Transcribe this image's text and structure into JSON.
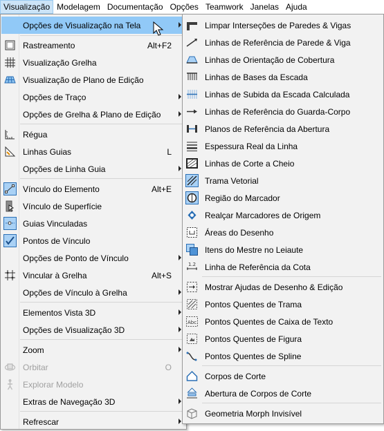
{
  "menubar": {
    "items": [
      "Visualização",
      "Modelagem",
      "Documentação",
      "Opções",
      "Teamwork",
      "Janelas",
      "Ajuda"
    ]
  },
  "main_menu": {
    "items": [
      {
        "label": "Opções de Visualização na Tela",
        "shortcut": "",
        "submenu": true,
        "icon": "none"
      },
      {
        "label": "Rastreamento",
        "shortcut": "Alt+F2",
        "submenu": false,
        "icon": "tracker-icon"
      },
      {
        "label": "Visualização Grelha",
        "shortcut": "",
        "submenu": false,
        "icon": "grid-display-icon"
      },
      {
        "label": "Visualização de Plano de Edição",
        "shortcut": "",
        "submenu": false,
        "icon": "editing-plane-icon"
      },
      {
        "label": "Opções de Traço",
        "shortcut": "",
        "submenu": true,
        "icon": "none"
      },
      {
        "label": "Opções de Grelha & Plano de Edição",
        "shortcut": "",
        "submenu": true,
        "icon": "none"
      },
      {
        "label": "Régua",
        "shortcut": "",
        "submenu": false,
        "icon": "ruler-icon"
      },
      {
        "label": "Linhas Guias",
        "shortcut": "L",
        "submenu": false,
        "icon": "guide-lines-icon"
      },
      {
        "label": "Opções de Linha Guia",
        "shortcut": "",
        "submenu": true,
        "icon": "none"
      },
      {
        "label": "Vínculo do Elemento",
        "shortcut": "Alt+E",
        "submenu": false,
        "icon": "element-snap-icon"
      },
      {
        "label": "Vínculo de Superfície",
        "shortcut": "",
        "submenu": false,
        "icon": "surface-snap-icon"
      },
      {
        "label": "Guias Vinculadas",
        "shortcut": "",
        "submenu": false,
        "icon": "snap-guides-icon"
      },
      {
        "label": "Pontos de Vínculo",
        "shortcut": "",
        "submenu": false,
        "icon": "snap-points-icon"
      },
      {
        "label": "Opções de Ponto de Vínculo",
        "shortcut": "",
        "submenu": true,
        "icon": "none"
      },
      {
        "label": "Vincular à Grelha",
        "shortcut": "Alt+S",
        "submenu": false,
        "icon": "grid-snap-icon"
      },
      {
        "label": "Opções de Vínculo à Grelha",
        "shortcut": "",
        "submenu": true,
        "icon": "none"
      },
      {
        "label": "Elementos Vista 3D",
        "shortcut": "",
        "submenu": true,
        "icon": "none"
      },
      {
        "label": "Opções de Visualização 3D",
        "shortcut": "",
        "submenu": true,
        "icon": "none"
      },
      {
        "label": "Zoom",
        "shortcut": "",
        "submenu": true,
        "icon": "none"
      },
      {
        "label": "Orbitar",
        "shortcut": "O",
        "submenu": false,
        "icon": "orbit-icon",
        "disabled": true
      },
      {
        "label": "Explorar Modelo",
        "shortcut": "",
        "submenu": false,
        "icon": "explore-model-icon",
        "disabled": true
      },
      {
        "label": "Extras de Navegação 3D",
        "shortcut": "",
        "submenu": true,
        "icon": "none"
      },
      {
        "label": "Refrescar",
        "shortcut": "",
        "submenu": true,
        "icon": "none"
      }
    ]
  },
  "sub_menu": {
    "items": [
      {
        "label": "Limpar Interseções  de Paredes & Vigas",
        "icon": "clean-intersections-icon"
      },
      {
        "label": "Linhas de Referência de Parede & Viga",
        "icon": "reference-line-icon"
      },
      {
        "label": "Linhas de Orientação de Cobertura",
        "icon": "roof-pivot-icon"
      },
      {
        "label": "Linhas de Bases da Escada",
        "icon": "stair-baseline-icon"
      },
      {
        "label": "Linhas de Subida da Escada Calculada",
        "icon": "stair-walkline-icon"
      },
      {
        "label": "Linhas de Referência do Guarda-Corpo",
        "icon": "railing-reference-icon"
      },
      {
        "label": "Planos de Referência da Abertura",
        "icon": "opening-reference-icon"
      },
      {
        "label": "Espessura Real da Linha",
        "icon": "true-line-weight-icon"
      },
      {
        "label": "Linhas de Corte a Cheio",
        "icon": "bold-cut-lines-icon"
      },
      {
        "label": "Trama Vetorial",
        "icon": "vectorial-hatching-icon"
      },
      {
        "label": "Região do Marcador",
        "icon": "marker-region-icon"
      },
      {
        "label": "Realçar Marcadores de Origem",
        "icon": "source-markers-icon"
      },
      {
        "label": "Áreas do Desenho",
        "icon": "drawing-areas-icon"
      },
      {
        "label": "Itens do Mestre no Leiaute",
        "icon": "master-items-icon"
      },
      {
        "label": "Linha de Referência da Cota",
        "icon": "dimension-reference-icon"
      },
      {
        "label": "Mostrar Ajudas de Desenho & Edição",
        "icon": "drawing-aids-icon"
      },
      {
        "label": "Pontos Quentes de Trama",
        "icon": "hatch-hotspots-icon"
      },
      {
        "label": "Pontos Quentes de Caixa de Texto",
        "icon": "textbox-hotspots-icon"
      },
      {
        "label": "Pontos Quentes de Figura",
        "icon": "figure-hotspots-icon"
      },
      {
        "label": "Pontos Quentes de Spline",
        "icon": "spline-hotspots-icon"
      },
      {
        "label": "Corpos de Corte",
        "icon": "cutting-bodies-icon"
      },
      {
        "label": "Abertura de Corpos de Corte",
        "icon": "cutting-body-opening-icon"
      },
      {
        "label": "Geometria Morph Invisível",
        "icon": "morph-geometry-icon"
      }
    ]
  },
  "colors": {
    "menu_bg": "#f2f2f2",
    "highlight": "#91c9f7",
    "active_menubar": "#cce4f7",
    "disabled_text": "#a0a0a0"
  }
}
